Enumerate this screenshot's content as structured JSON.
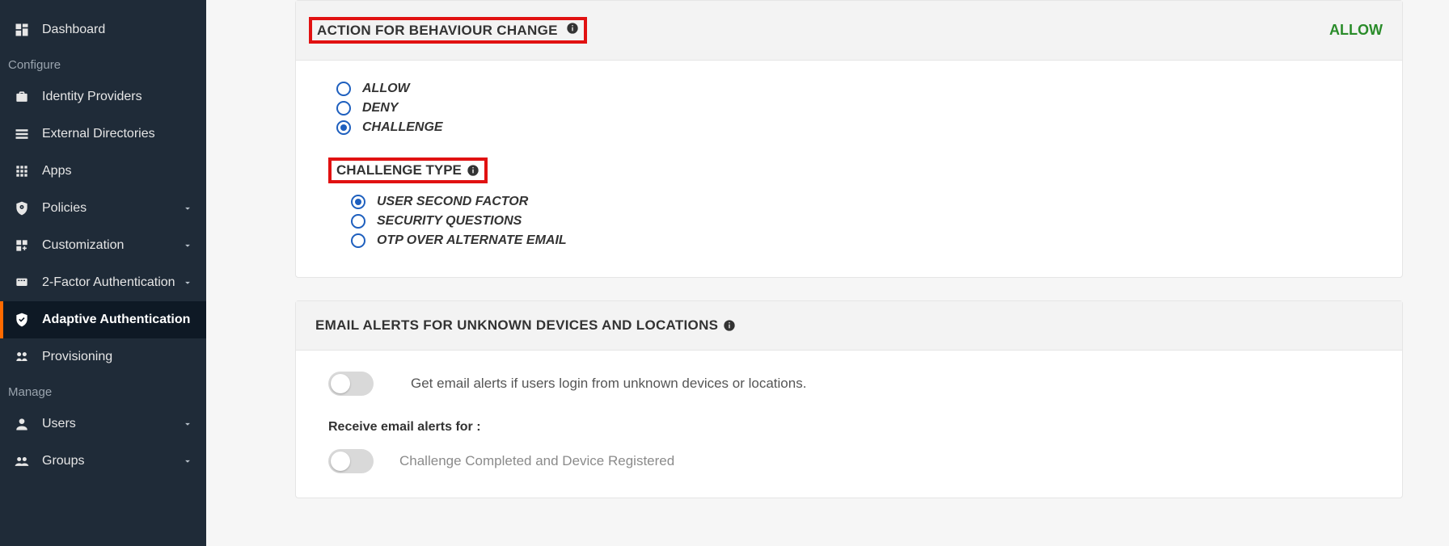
{
  "sidebar": {
    "section_configure": "Configure",
    "section_manage": "Manage",
    "items": {
      "dashboard": "Dashboard",
      "identity_providers": "Identity Providers",
      "external_directories": "External Directories",
      "apps": "Apps",
      "policies": "Policies",
      "customization": "Customization",
      "two_factor": "2-Factor Authentication",
      "adaptive_auth": "Adaptive Authentication",
      "provisioning": "Provisioning",
      "users": "Users",
      "groups": "Groups"
    }
  },
  "panel1": {
    "title": "ACTION FOR BEHAVIOUR CHANGE",
    "status": "ALLOW",
    "actions": {
      "allow": "ALLOW",
      "deny": "DENY",
      "challenge": "CHALLENGE"
    },
    "selected_action": "challenge",
    "challenge_title": "CHALLENGE TYPE",
    "challenge_types": {
      "user_second_factor": "USER SECOND FACTOR",
      "security_questions": "SECURITY QUESTIONS",
      "otp_alt_email": "OTP OVER ALTERNATE EMAIL"
    },
    "selected_challenge": "user_second_factor"
  },
  "panel2": {
    "title": "EMAIL ALERTS FOR UNKNOWN DEVICES AND LOCATIONS",
    "toggle_desc": "Get email alerts if users login from unknown devices or locations.",
    "receive_title": "Receive email alerts for :",
    "option1": "Challenge Completed and Device Registered"
  }
}
